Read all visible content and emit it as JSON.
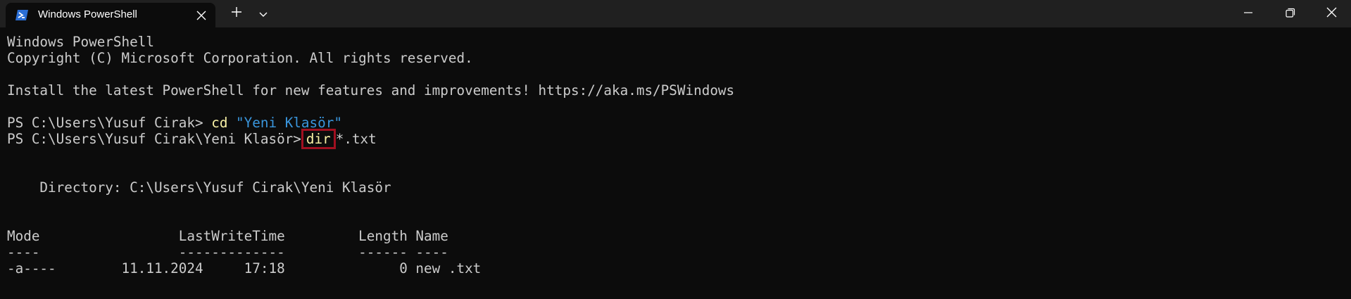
{
  "titlebar": {
    "tab_title": "Windows PowerShell",
    "tab_icon": "powershell-icon",
    "close_tab_icon": "close-icon",
    "new_tab_icon": "plus-icon",
    "dropdown_icon": "chevron-down-icon",
    "window_controls": [
      "minimize-icon",
      "restore-icon",
      "close-icon"
    ]
  },
  "terminal": {
    "banner_title": "Windows PowerShell",
    "copyright": "Copyright (C) Microsoft Corporation. All rights reserved.",
    "install_notice": "Install the latest PowerShell for new features and improvements! https://aka.ms/PSWindows",
    "prompt1": "PS C:\\Users\\Yusuf Cirak> ",
    "cmd1_keyword": "cd",
    "cmd1_arg": "\"Yeni Klasör\"",
    "prompt2": "PS C:\\Users\\Yusuf Cirak\\Yeni Klasör>",
    "cmd2_keyword": "dir",
    "cmd2_arg": "*.txt",
    "directory_line": "    Directory: C:\\Users\\Yusuf Cirak\\Yeni Klasör",
    "header_line": "Mode                 LastWriteTime         Length Name",
    "separator_line": "----                 -------------         ------ ----",
    "file_row": "-a----        11.11.2024     17:18              0 new .txt"
  },
  "colors": {
    "background": "#0c0c0c",
    "titlebar": "#202020",
    "text": "#cccccc",
    "command_keyword": "#f9f1a5",
    "string": "#3a96dd",
    "highlight_box": "#a01020"
  }
}
